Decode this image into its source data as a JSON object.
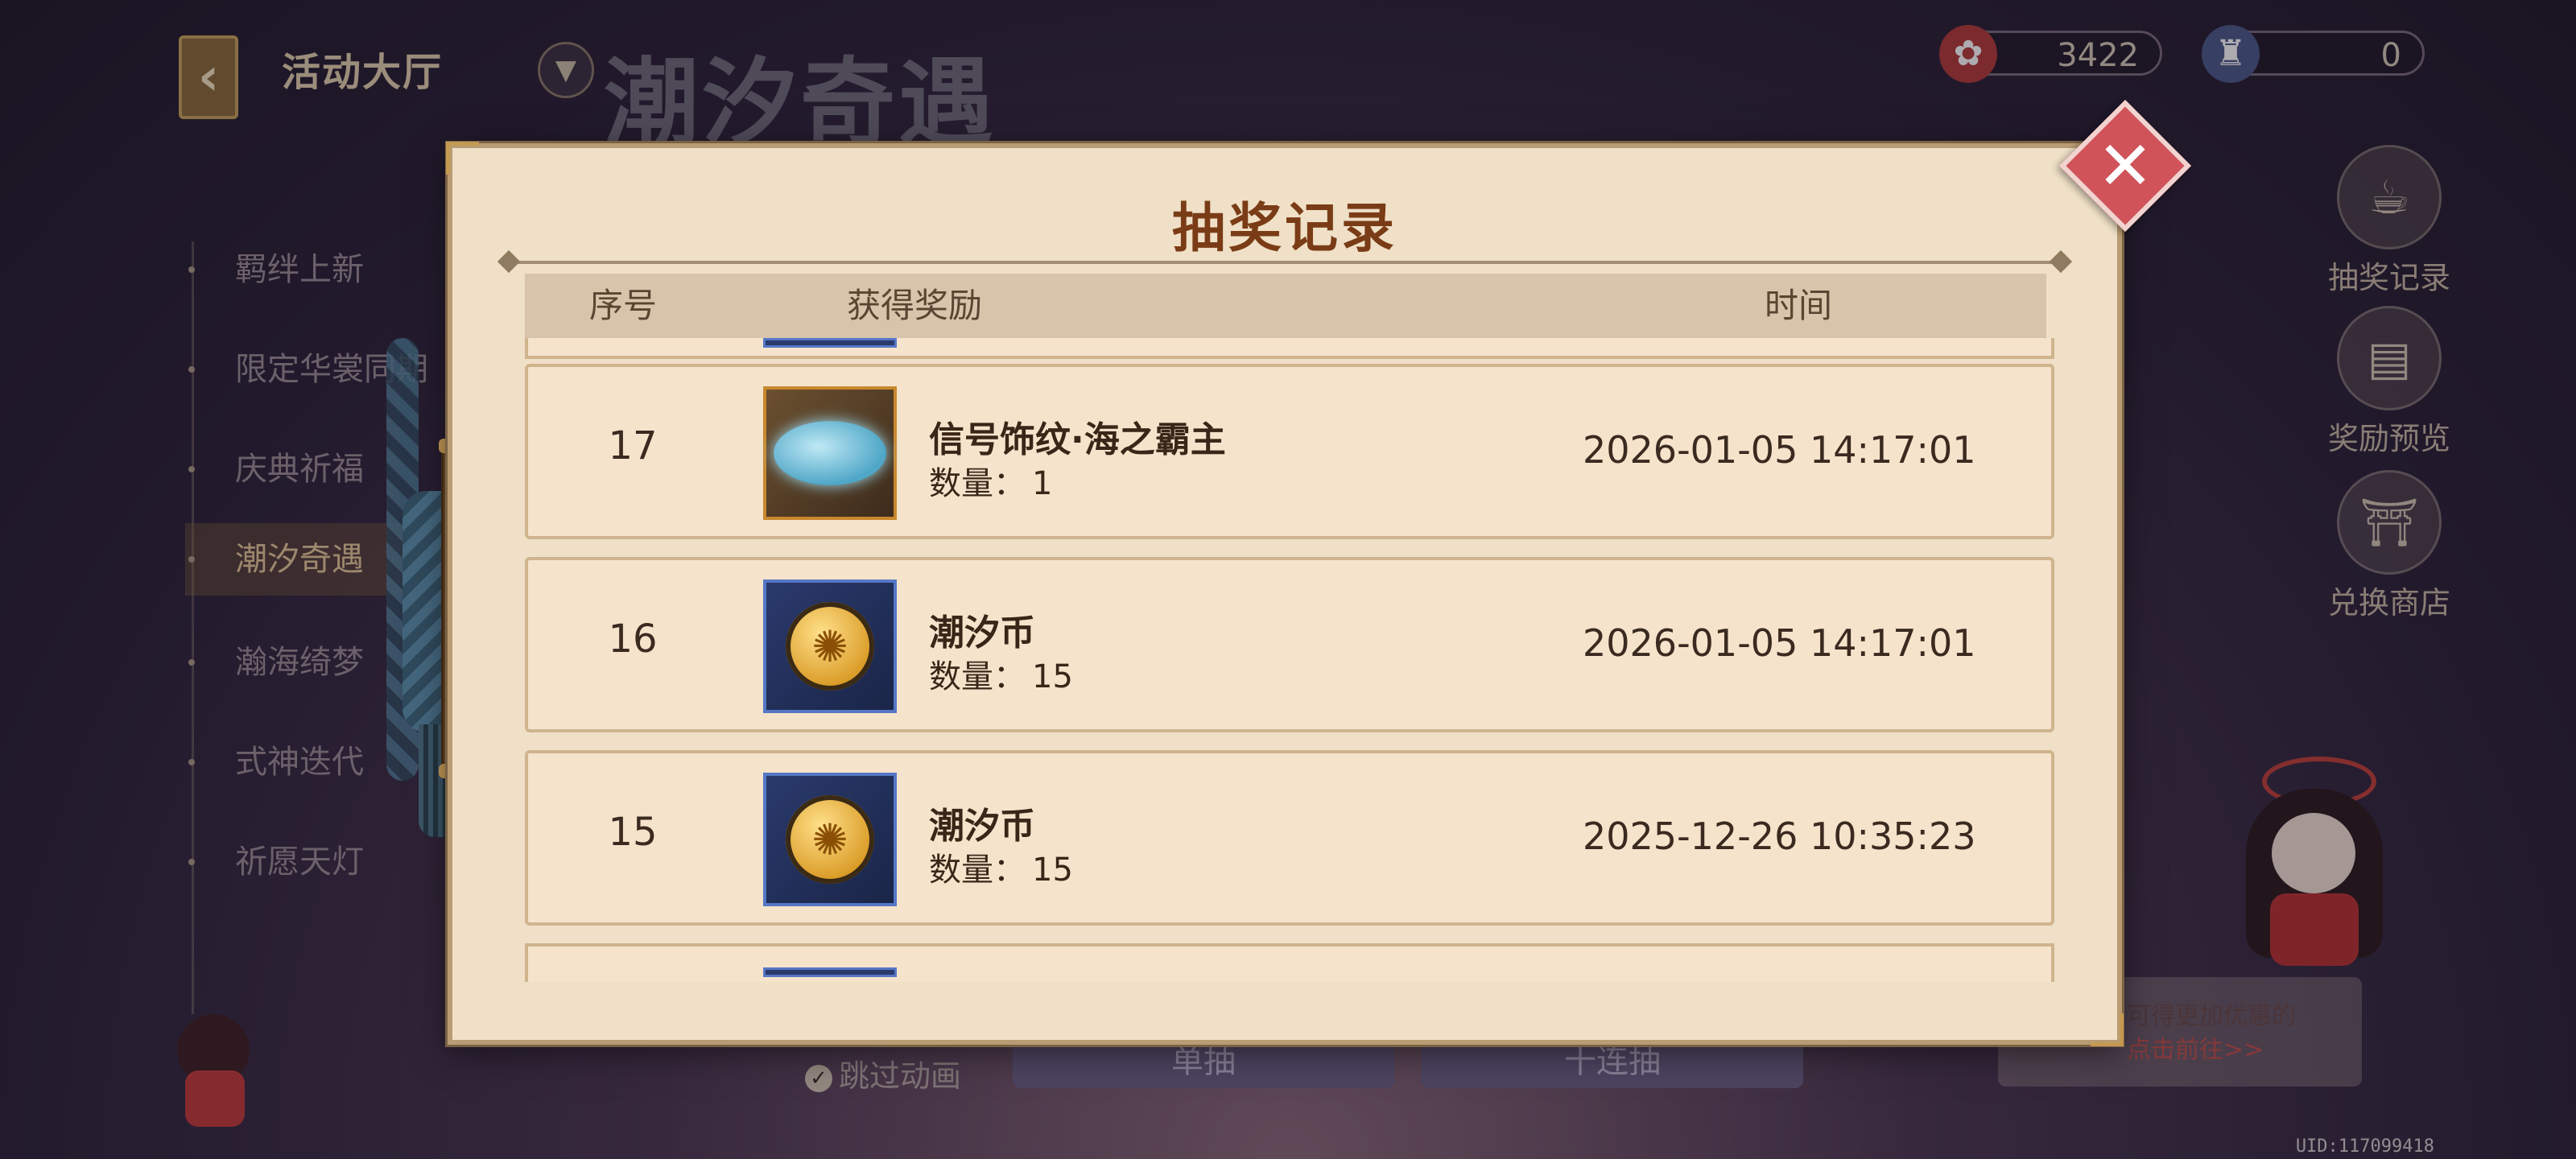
{
  "header": {
    "back_label": "活动大厅",
    "page_title": "潮汐奇遇",
    "currencies": [
      {
        "icon": "medal-icon",
        "value": "3422"
      },
      {
        "icon": "lantern-icon",
        "value": "0"
      }
    ]
  },
  "sidebar": {
    "items": [
      {
        "label": "羁绊上新"
      },
      {
        "label": "限定华裳同期"
      },
      {
        "label": "庆典祈福"
      },
      {
        "label": "潮汐奇遇",
        "active": true
      },
      {
        "label": "瀚海绮梦"
      },
      {
        "label": "式神迭代"
      },
      {
        "label": "祈愿天灯"
      }
    ]
  },
  "right_panel": {
    "draw_record": "抽奖记录",
    "reward_preview": "奖励预览",
    "exchange_shop": "兑换商店"
  },
  "bottom": {
    "skip_animation": "跳过动画",
    "single_draw": "单抽",
    "ten_draw": "十连抽",
    "promo_line1": "可得更加优惠的",
    "promo_link": "点击前往>>",
    "uid": "UID:117099418"
  },
  "modal": {
    "title": "抽奖记录",
    "columns": {
      "index": "序号",
      "reward": "获得奖励",
      "time": "时间"
    },
    "quantity_label": "数量：",
    "rows": [
      {
        "index": "17",
        "icon": "whale-frame-icon",
        "name": "信号饰纹·海之霸主",
        "quantity": "1",
        "time": "2026-01-05 14:17:01"
      },
      {
        "index": "16",
        "icon": "tide-coin-icon",
        "name": "潮汐币",
        "quantity": "15",
        "time": "2026-01-05 14:17:01"
      },
      {
        "index": "15",
        "icon": "tide-coin-icon",
        "name": "潮汐币",
        "quantity": "15",
        "time": "2025-12-26 10:35:23"
      }
    ]
  },
  "colors": {
    "modal_bg": "#efe0c7",
    "row_bg": "#f5e4cb",
    "title_brown": "#7a3c16",
    "close_red": "#d0535a"
  }
}
